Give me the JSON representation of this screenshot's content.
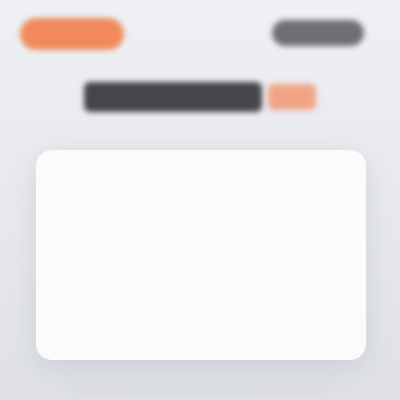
{
  "theme": {
    "page_background": "#e9ebef",
    "card_background": "#fbfbfc",
    "accent": "#f08a5d",
    "headline_dark": "#44464c",
    "headline_accent": "#f1a386",
    "header_control": "#6e7076"
  },
  "header": {
    "logo_text": "",
    "control_text": ""
  },
  "hero": {
    "headline_text": "",
    "headline_accent_text": ""
  },
  "card": {
    "content_text": ""
  }
}
